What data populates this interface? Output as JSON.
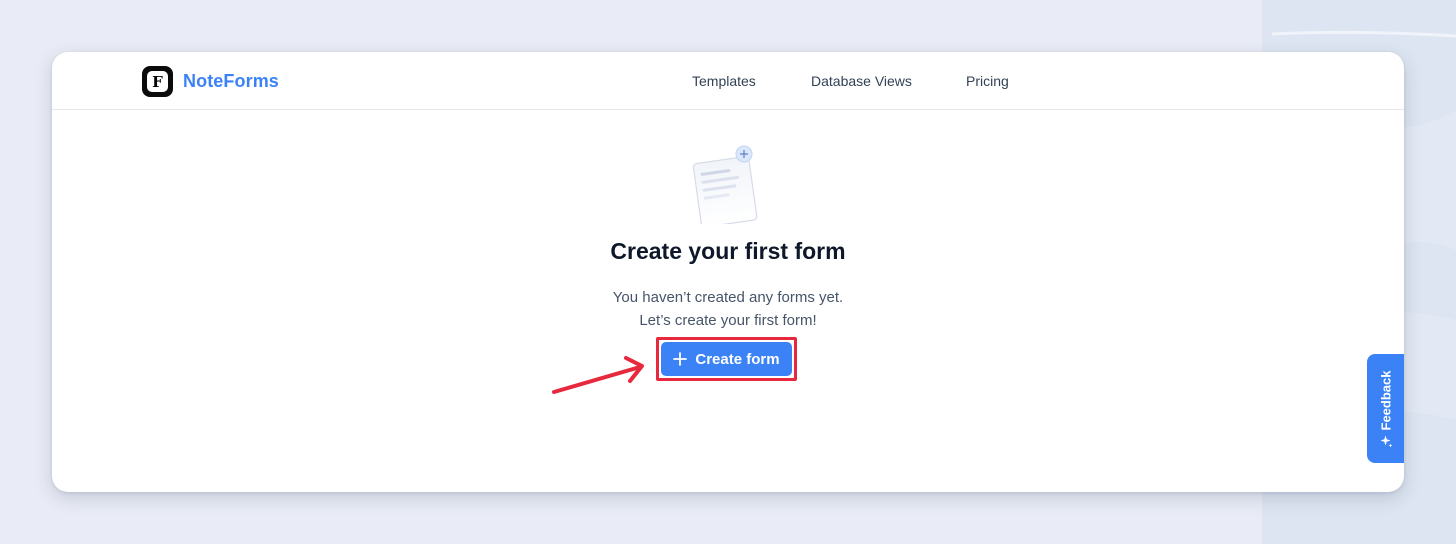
{
  "brand": {
    "name": "NoteForms",
    "logo_letter": "F",
    "accent_color": "#3b82f6"
  },
  "nav": {
    "items": [
      {
        "label": "Templates"
      },
      {
        "label": "Database Views"
      },
      {
        "label": "Pricing"
      }
    ]
  },
  "empty_state": {
    "illustration_icon": "document-plus-icon",
    "title": "Create your first form",
    "subtitle_line1": "You haven’t created any forms yet.",
    "subtitle_line2": "Let’s create your first form!",
    "create_button_label": "Create form",
    "create_button_icon": "plus-icon"
  },
  "annotation": {
    "highlight_color": "#e8283c",
    "arrow_icon": "arrow-right-icon"
  },
  "feedback": {
    "label": "Feedback",
    "icon": "sparkle-icon"
  }
}
